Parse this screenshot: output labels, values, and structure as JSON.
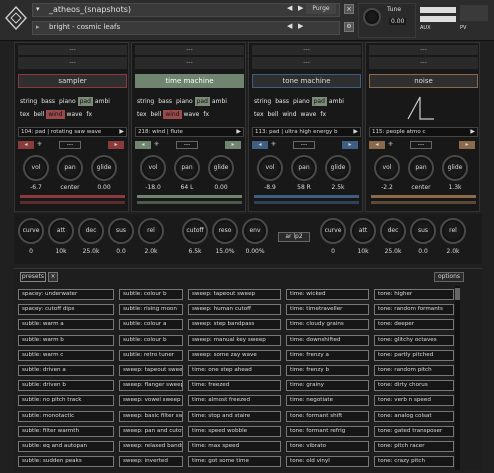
{
  "header": {
    "instrument_name": "_atheos_(snapshots)",
    "preset_name": "bright - cosmic leafs",
    "purge_label": "Purge",
    "tune_label": "Tune",
    "tune_value": "0.00",
    "aux_label": "AUX",
    "pv_label": "PV"
  },
  "slots": [
    {
      "name": "sampler",
      "color": "#8b3b3b",
      "preset": "104: pad | rotating saw wave",
      "vol": "-6.7",
      "pan": "center",
      "glide": "0.00",
      "cats_row1": [
        "string",
        "bass",
        "piano",
        "pad",
        "ambi"
      ],
      "cats_row2": [
        "tex",
        "bell",
        "wind",
        "wave",
        "fx"
      ],
      "active1": 3,
      "active2": 2
    },
    {
      "name": "time machine",
      "color": "#6f8570",
      "preset": "218: wind | flute",
      "vol": "-18.0",
      "pan": "64 L",
      "glide": "0.00",
      "cats_row1": [
        "string",
        "bass",
        "piano",
        "pad",
        "ambi"
      ],
      "cats_row2": [
        "tex",
        "bell",
        "wind",
        "wave",
        "fx"
      ],
      "active1": 3,
      "active2": 2
    },
    {
      "name": "tone machine",
      "color": "#3e5f82",
      "preset": "113: pad | ultra high energy b",
      "vol": "-8.9",
      "pan": "58 R",
      "glide": "2.5k",
      "cats_row1": [
        "string",
        "bass",
        "piano",
        "pad",
        "ambi"
      ],
      "cats_row2": [
        "tex",
        "bell",
        "wind",
        "wave",
        "fx"
      ],
      "active1": 3,
      "active2": -1
    },
    {
      "name": "noise",
      "color": "#8a6a4a",
      "preset": "115: people atmo c",
      "vol": "-2.2",
      "pan": "center",
      "glide": "1.3k",
      "cats_row1": [],
      "cats_row2": [],
      "active1": -1,
      "active2": -1
    }
  ],
  "slot_stub": "---",
  "env": {
    "left": [
      {
        "label": "curve",
        "value": "0"
      },
      {
        "label": "att",
        "value": "10k"
      },
      {
        "label": "dec",
        "value": "25.0k"
      },
      {
        "label": "sus",
        "value": "0.0"
      },
      {
        "label": "rel",
        "value": "2.0k"
      }
    ],
    "filter": [
      {
        "label": "cutoff",
        "value": "6.5k"
      },
      {
        "label": "reso",
        "value": "15.0%"
      },
      {
        "label": "env",
        "value": "0.00%"
      }
    ],
    "filter_type": "ar lp2",
    "right": [
      {
        "label": "curve",
        "value": "0"
      },
      {
        "label": "att",
        "value": "10k"
      },
      {
        "label": "dec",
        "value": "25.0k"
      },
      {
        "label": "sus",
        "value": "0.0"
      },
      {
        "label": "rel",
        "value": "2.0k"
      }
    ]
  },
  "browser": {
    "presets_label": "presets",
    "options_label": "options",
    "rows": [
      [
        "spacey: underwater",
        "subtle: colour b",
        "sweep: tapeout sweep",
        "time: wicked",
        "tone: higher"
      ],
      [
        "spacey: cutoff dips",
        "subtle: rising moon",
        "sweep: human cutoff",
        "time: timetraveller",
        "tone: random formants"
      ],
      [
        "subtle: warm a",
        "subtle: colour a",
        "sweep: step bandpass",
        "time: cloudy grains",
        "tone: deeper"
      ],
      [
        "subtle: warm b",
        "subtle: colour b",
        "sweep: manual key sweep",
        "time: downshifted",
        "tone: glitchy octaves"
      ],
      [
        "subtle: warm c",
        "subtle: retro tuner",
        "sweep: some zay wave",
        "time: frenzy a",
        "tone: partly pitched"
      ],
      [
        "subtle: driven a",
        "sweep: tapeout sweep",
        "time: one step ahead",
        "time: frenzy b",
        "tone: random pitch"
      ],
      [
        "subtle: driven b",
        "sweep: flanger sweep",
        "time: freezed",
        "time: grainy",
        "tone: dirty chorus"
      ],
      [
        "subtle: no pitch track",
        "sweep: vowel sweep",
        "time: almost freezed",
        "time: negotiate",
        "tone: verb n speed"
      ],
      [
        "subtle: monotactic",
        "sweep: basic filter sweep",
        "time: stop and staire",
        "tone: formant shift",
        "tone: analog colsat"
      ],
      [
        "subtle: filter warmth",
        "sweep: pan and cutoff",
        "time: speed wobble",
        "tone: formant refrig",
        "tone: gated transposer"
      ],
      [
        "subtle: eq and autopan",
        "sweep: relaxed bands",
        "time: max speed",
        "tone: vibrato",
        "tone: pitch racer"
      ],
      [
        "subtle: sudden peaks",
        "sweep: inverted",
        "time: got some time",
        "tone: old vinyl",
        "tone: crazy pitch"
      ]
    ]
  }
}
